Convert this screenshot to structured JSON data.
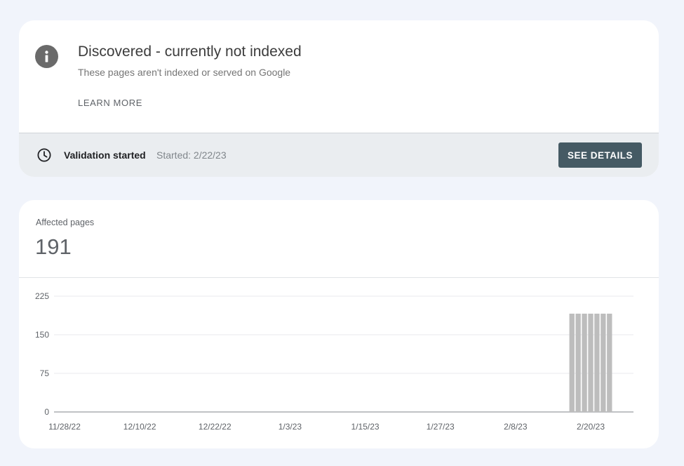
{
  "issue": {
    "icon": "info-icon",
    "title": "Discovered - currently not indexed",
    "subtitle": "These pages aren't indexed or served on Google",
    "learn_more_label": "LEARN MORE"
  },
  "validation": {
    "icon": "clock-icon",
    "status": "Validation started",
    "started_text": "Started: 2/22/23",
    "button_label": "SEE DETAILS"
  },
  "metric": {
    "label": "Affected pages",
    "value": "191"
  },
  "colors": {
    "bar": "#bdbdbd",
    "button": "#455a64",
    "validation_bar": "#eaedf0"
  },
  "chart_data": {
    "type": "bar",
    "title": "",
    "xlabel": "",
    "ylabel": "",
    "ylim": [
      0,
      225
    ],
    "y_ticks": [
      "0",
      "75",
      "150",
      "225"
    ],
    "x_tick_labels": [
      "11/28/22",
      "12/10/22",
      "12/22/22",
      "1/3/23",
      "1/15/23",
      "1/27/23",
      "2/8/23",
      "2/20/23"
    ],
    "x_start_label": "11/28/22",
    "categories": [
      "2/17/23",
      "2/18/23",
      "2/19/23",
      "2/20/23",
      "2/21/23",
      "2/22/23",
      "2/23/23"
    ],
    "values": [
      191,
      191,
      191,
      191,
      191,
      191,
      191
    ],
    "grid": true,
    "legend": "none"
  }
}
